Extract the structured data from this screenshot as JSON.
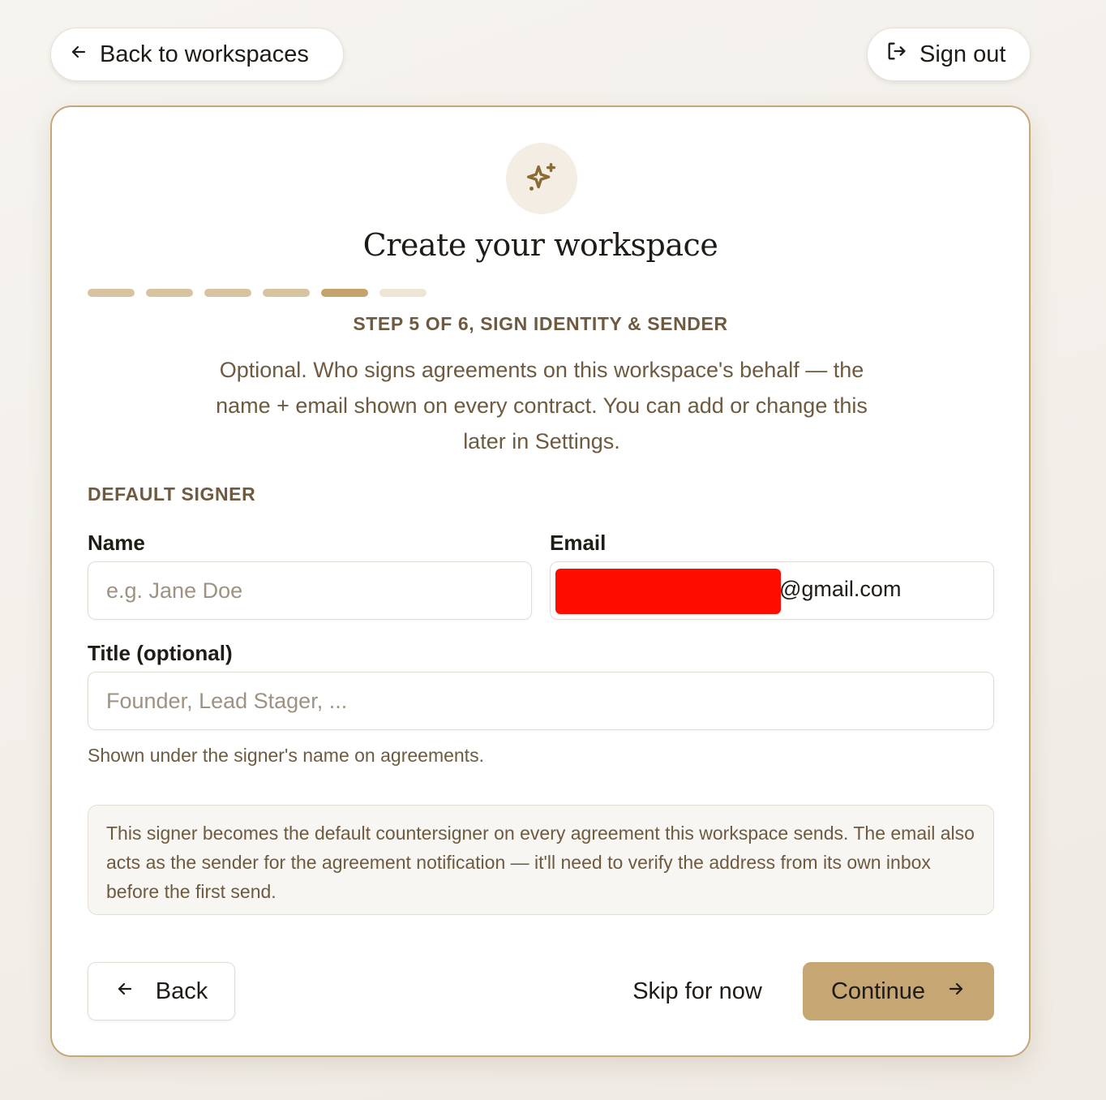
{
  "top_nav": {
    "back_label": "Back to workspaces",
    "signout_label": "Sign out"
  },
  "card": {
    "icon": "sparkles-icon",
    "title": "Create your workspace",
    "progress": {
      "current_step": 5,
      "total_steps": 6,
      "colors": {
        "done": "#d8c3a0",
        "current": "#c4a46c",
        "todo": "#efe5d6"
      }
    },
    "step_label": "STEP 5 OF 6, SIGN IDENTITY & SENDER",
    "description": "Optional. Who signs agreements on this workspace's behalf — the name + email shown on every contract. You can add or change this later in Settings.",
    "section_label": "DEFAULT SIGNER",
    "fields": {
      "name": {
        "label": "Name",
        "value": "",
        "placeholder": "e.g. Jane Doe"
      },
      "email": {
        "label": "Email",
        "value_visible": "@gmail.com",
        "redacted": true
      },
      "title": {
        "label": "Title (optional)",
        "value": "",
        "placeholder": "Founder, Lead Stager, ..."
      }
    },
    "hint": "Shown under the signer's name on agreements.",
    "info_text": "This signer becomes the default countersigner on every agreement this workspace sends. The email also acts as the sender for the agreement notification — it'll need to verify the address from its own inbox before the first send.",
    "actions": {
      "back_label": "Back",
      "skip_label": "Skip for now",
      "continue_label": "Continue"
    }
  },
  "colors": {
    "accent": "#c6a672",
    "card_border": "#c6a877",
    "muted_text": "#6e5a3f",
    "redaction": "#ff0d00"
  }
}
